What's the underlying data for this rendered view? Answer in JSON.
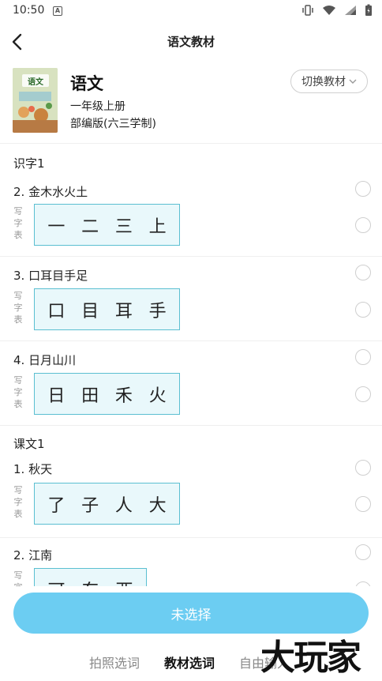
{
  "status_bar": {
    "time": "10:50",
    "notification_icon": "A"
  },
  "header": {
    "title": "语文教材"
  },
  "book": {
    "subject": "语文",
    "grade": "一年级上册",
    "edition": "部编版(六三学制)",
    "switch_label": "切换教材",
    "cover_text": "语文"
  },
  "write_label": [
    "写",
    "字",
    "表"
  ],
  "sections": [
    {
      "title": "识字1",
      "lessons": [
        {
          "title": "2. 金木水火土",
          "chars": [
            "一",
            "二",
            "三",
            "上"
          ]
        },
        {
          "title": "3. 口耳目手足",
          "chars": [
            "口",
            "目",
            "耳",
            "手"
          ]
        },
        {
          "title": "4. 日月山川",
          "chars": [
            "日",
            "田",
            "禾",
            "火"
          ]
        }
      ]
    },
    {
      "title": "课文1",
      "lessons": [
        {
          "title": "1. 秋天",
          "chars": [
            "了",
            "子",
            "人",
            "大"
          ]
        },
        {
          "title": "2. 江南",
          "chars": [
            "可",
            "东",
            "西"
          ]
        }
      ]
    }
  ],
  "cta_label": "未选择",
  "tabs": [
    {
      "label": "拍照选词",
      "active": false
    },
    {
      "label": "教材选词",
      "active": true
    },
    {
      "label": "自由输入",
      "active": false
    }
  ],
  "watermark": "大玩家"
}
